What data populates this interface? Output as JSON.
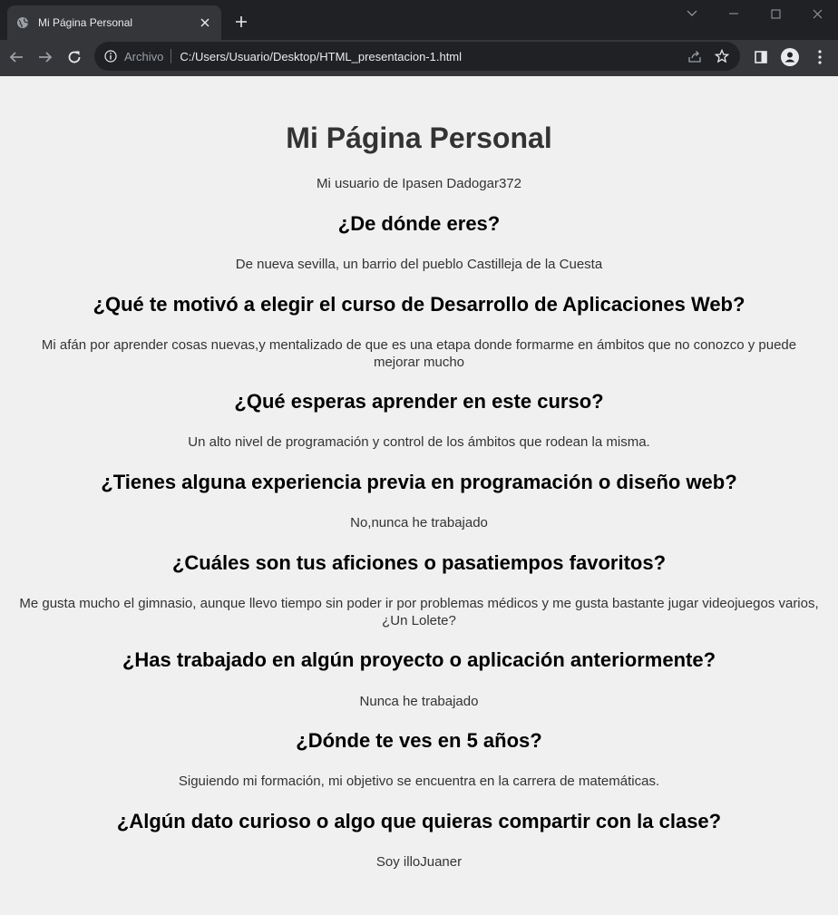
{
  "browser": {
    "tab_title": "Mi Página Personal",
    "omnibox_scheme": "Archivo",
    "omnibox_url": "C:/Users/Usuario/Desktop/HTML_presentacion-1.html",
    "icons": [
      "globe-icon",
      "close-icon",
      "plus-icon",
      "chevron-down-icon",
      "minimize-icon",
      "maximize-icon",
      "window-close-icon",
      "back-arrow-icon",
      "forward-arrow-icon",
      "reload-icon",
      "info-icon",
      "share-icon",
      "star-icon",
      "side-panel-icon",
      "profile-icon",
      "kebab-menu-icon"
    ],
    "colors": {
      "frame": "#202124",
      "toolbar": "#35363a",
      "text": "#e8eaed"
    }
  },
  "page": {
    "title": "Mi Página Personal",
    "user_line": "Mi usuario de Ipasen Dadogar372",
    "sections": [
      {
        "question": "¿De dónde eres?",
        "answer": "De nueva sevilla, un barrio del pueblo Castilleja de la Cuesta"
      },
      {
        "question": "¿Qué te motivó a elegir el curso de Desarrollo de Aplicaciones Web?",
        "answer": "Mi afán por aprender cosas nuevas,y mentalizado de que es una etapa donde formarme en ámbitos que no conozco y puede mejorar mucho"
      },
      {
        "question": "¿Qué esperas aprender en este curso?",
        "answer": "Un alto nivel de programación y control de los ámbitos que rodean la misma."
      },
      {
        "question": "¿Tienes alguna experiencia previa en programación o diseño web?",
        "answer": "No,nunca he trabajado"
      },
      {
        "question": "¿Cuáles son tus aficiones o pasatiempos favoritos?",
        "answer": "Me gusta mucho el gimnasio, aunque llevo tiempo sin poder ir por problemas médicos y me gusta bastante jugar videojuegos varios,¿Un Lolete?"
      },
      {
        "question": "¿Has trabajado en algún proyecto o aplicación anteriormente?",
        "answer": "Nunca he trabajado"
      },
      {
        "question": "¿Dónde te ves en 5 años?",
        "answer": "Siguiendo mi formación, mi objetivo se encuentra en la carrera de matemáticas."
      },
      {
        "question": "¿Algún dato curioso o algo que quieras compartir con la clase?",
        "answer": "Soy illoJuaner"
      }
    ]
  }
}
